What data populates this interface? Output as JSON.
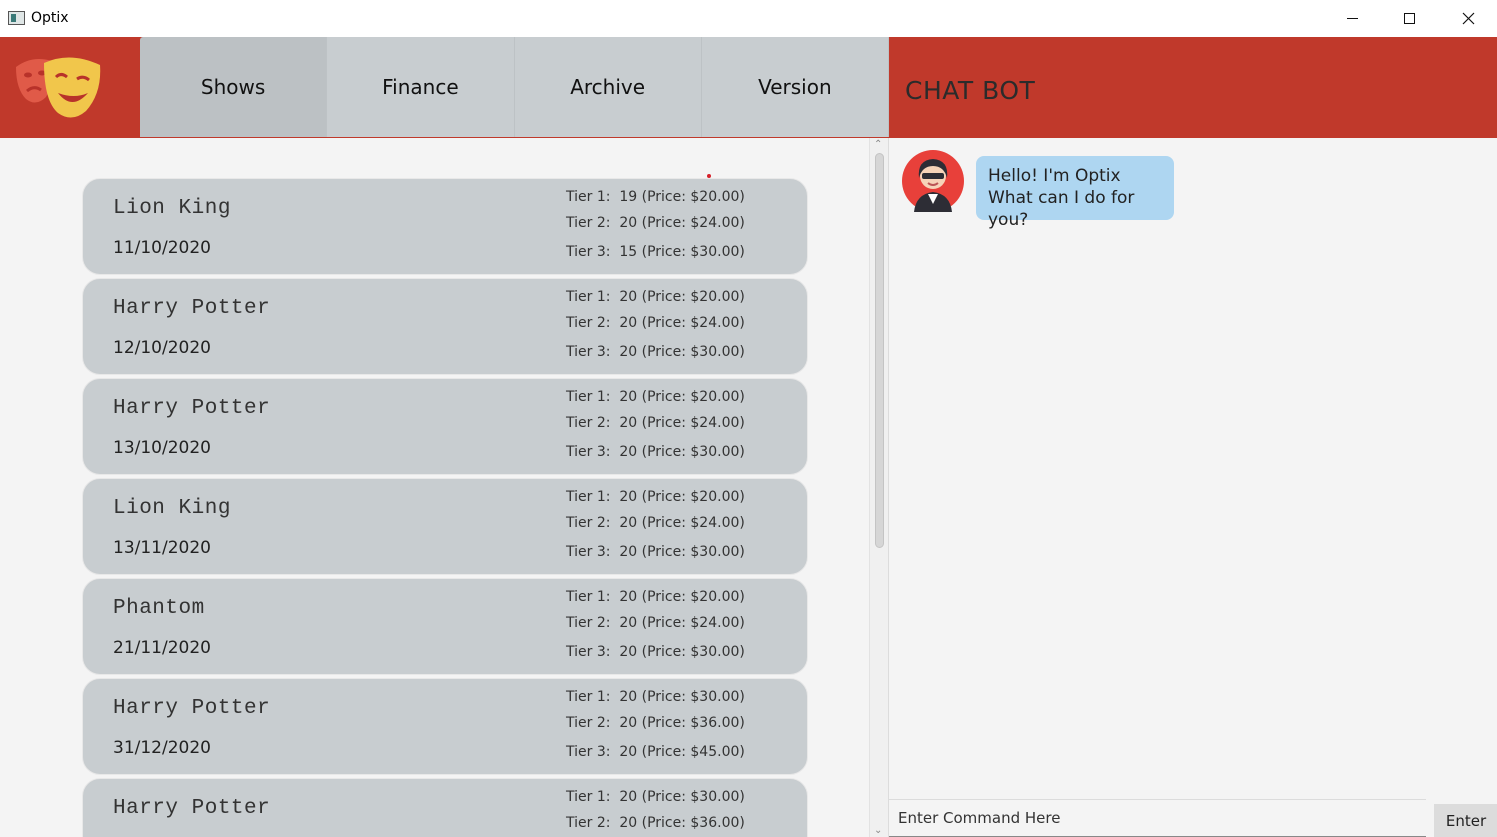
{
  "window": {
    "title": "Optix"
  },
  "tabs": [
    {
      "label": "Shows",
      "active": true
    },
    {
      "label": "Finance",
      "active": false
    },
    {
      "label": "Archive",
      "active": false
    },
    {
      "label": "Version",
      "active": false
    }
  ],
  "chat": {
    "title": "CHAT BOT",
    "messages": [
      {
        "sender": "bot",
        "line1": "Hello! I'm Optix",
        "line2": "What can I do for you?"
      }
    ],
    "input_placeholder": "Enter Command Here",
    "enter_label": "Enter"
  },
  "shows": [
    {
      "name": "Lion King",
      "date": "11/10/2020",
      "tiers": [
        "Tier 1:  19 (Price: $20.00)",
        "Tier 2:  20 (Price: $24.00)",
        "Tier 3:  15 (Price: $30.00)"
      ]
    },
    {
      "name": "Harry Potter",
      "date": "12/10/2020",
      "tiers": [
        "Tier 1:  20 (Price: $20.00)",
        "Tier 2:  20 (Price: $24.00)",
        "Tier 3:  20 (Price: $30.00)"
      ]
    },
    {
      "name": "Harry Potter",
      "date": "13/10/2020",
      "tiers": [
        "Tier 1:  20 (Price: $20.00)",
        "Tier 2:  20 (Price: $24.00)",
        "Tier 3:  20 (Price: $30.00)"
      ]
    },
    {
      "name": "Lion King",
      "date": "13/11/2020",
      "tiers": [
        "Tier 1:  20 (Price: $20.00)",
        "Tier 2:  20 (Price: $24.00)",
        "Tier 3:  20 (Price: $30.00)"
      ]
    },
    {
      "name": "Phantom",
      "date": "21/11/2020",
      "tiers": [
        "Tier 1:  20 (Price: $20.00)",
        "Tier 2:  20 (Price: $24.00)",
        "Tier 3:  20 (Price: $30.00)"
      ]
    },
    {
      "name": "Harry Potter",
      "date": "31/12/2020",
      "tiers": [
        "Tier 1:  20 (Price: $30.00)",
        "Tier 2:  20 (Price: $36.00)",
        "Tier 3:  20 (Price: $45.00)"
      ]
    },
    {
      "name": "Harry Potter",
      "date": "",
      "tiers": [
        "Tier 1:  20 (Price: $30.00)",
        "Tier 2:  20 (Price: $36.00)",
        ""
      ]
    }
  ],
  "colors": {
    "header": "#c0392b",
    "tab": "#c8cdd0",
    "card": "#c8cdd0",
    "bubble": "#aed6f1",
    "panel": "#f4f4f4"
  },
  "icons": {
    "logo": "theater-masks-icon",
    "avatar": "bot-avatar-icon"
  }
}
